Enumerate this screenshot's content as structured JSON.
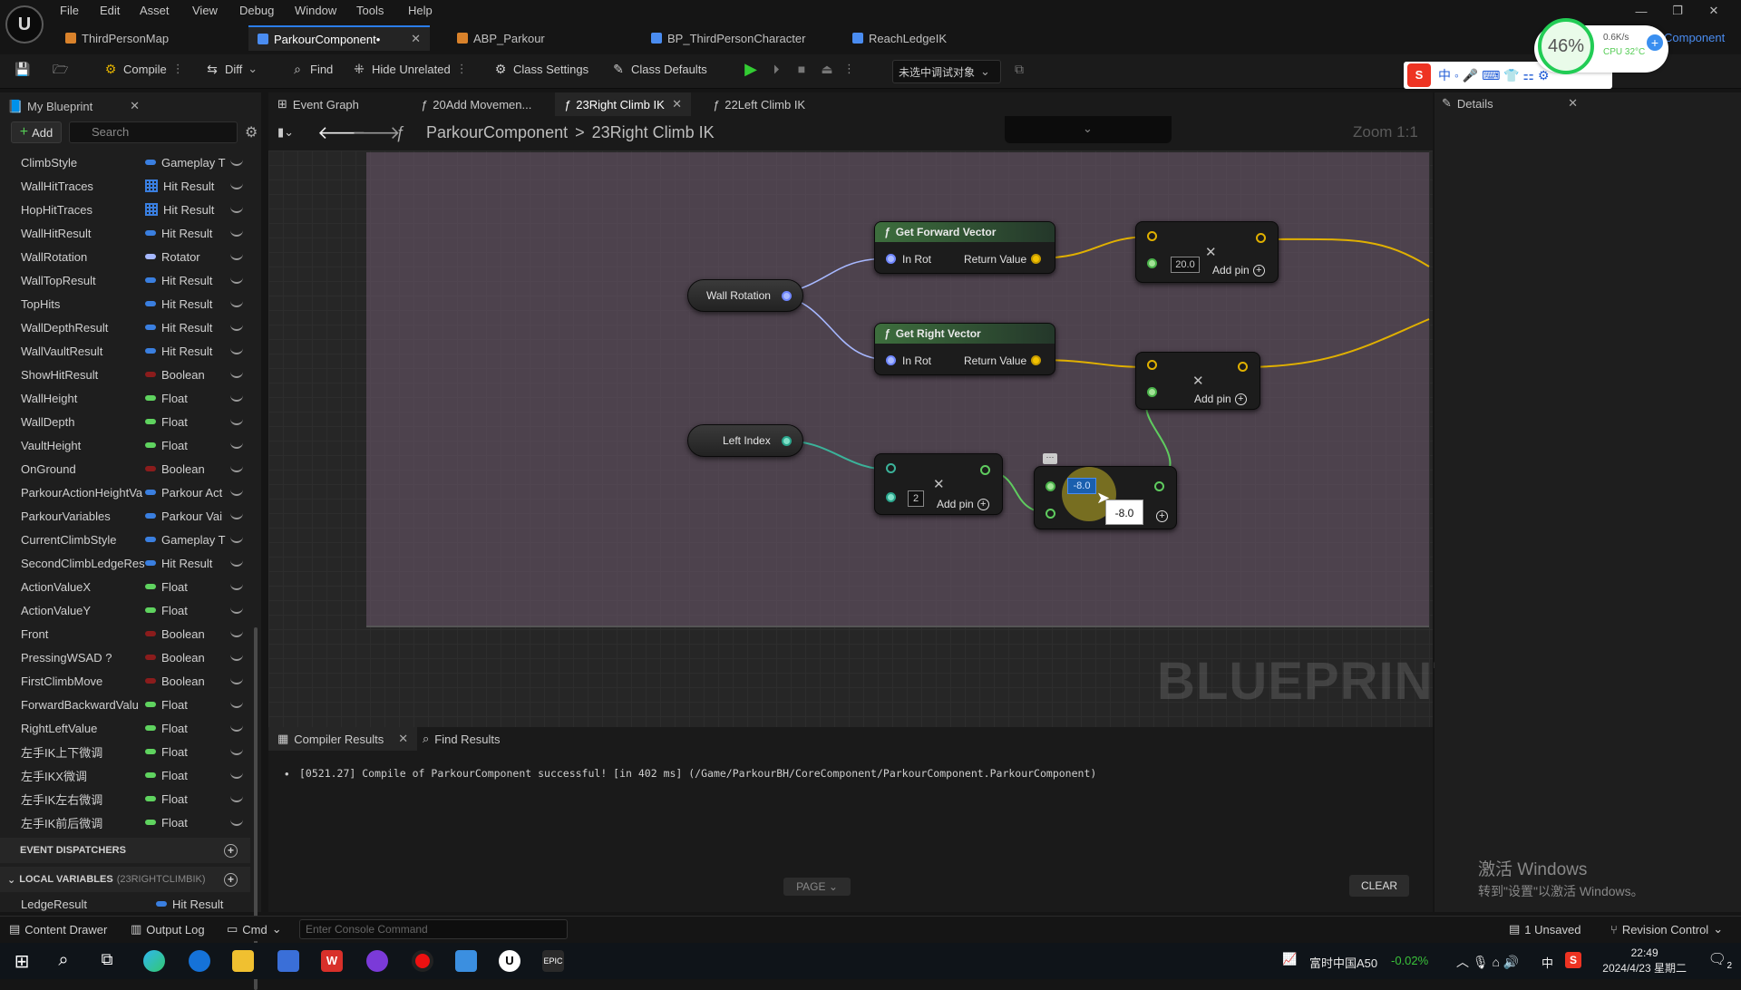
{
  "menu": [
    "File",
    "Edit",
    "Asset",
    "View",
    "Debug",
    "Window",
    "Tools",
    "Help"
  ],
  "doc_tabs": [
    {
      "label": "ThirdPersonMap",
      "color": "#d9822b"
    },
    {
      "label": "ParkourComponent•",
      "color": "#4a8cf0",
      "active": true
    },
    {
      "label": "ABP_Parkour",
      "color": "#d9822b"
    },
    {
      "label": "BP_ThirdPersonCharacter",
      "color": "#4a8cf0"
    },
    {
      "label": "ReachLedgeIK",
      "color": "#4a8cf0"
    }
  ],
  "top_right_link": "Component",
  "toolbar": {
    "compile": "Compile",
    "diff": "Diff",
    "find": "Find",
    "hide_unrelated": "Hide Unrelated",
    "class_settings": "Class Settings",
    "class_defaults": "Class Defaults",
    "debug_target": "未选中调试对象"
  },
  "my_blueprint": {
    "tab": "My Blueprint",
    "add": "Add",
    "search_placeholder": "Search",
    "variables": [
      {
        "name": "ClimbStyle",
        "type": "Gameplay T",
        "color": "#3a7fe0",
        "kind": "pill"
      },
      {
        "name": "WallHitTraces",
        "type": "Hit Result",
        "color": "#3a7fe0",
        "kind": "grid"
      },
      {
        "name": "HopHitTraces",
        "type": "Hit Result",
        "color": "#3a7fe0",
        "kind": "grid"
      },
      {
        "name": "WallHitResult",
        "type": "Hit Result",
        "color": "#3a7fe0",
        "kind": "pill"
      },
      {
        "name": "WallRotation",
        "type": "Rotator",
        "color": "#a6b8ff",
        "kind": "pill"
      },
      {
        "name": "WallTopResult",
        "type": "Hit Result",
        "color": "#3a7fe0",
        "kind": "pill"
      },
      {
        "name": "TopHits",
        "type": "Hit Result",
        "color": "#3a7fe0",
        "kind": "pill"
      },
      {
        "name": "WallDepthResult",
        "type": "Hit Result",
        "color": "#3a7fe0",
        "kind": "pill"
      },
      {
        "name": "WallVaultResult",
        "type": "Hit Result",
        "color": "#3a7fe0",
        "kind": "pill"
      },
      {
        "name": "ShowHitResult",
        "type": "Boolean",
        "color": "#8b1c1c",
        "kind": "pill"
      },
      {
        "name": "WallHeight",
        "type": "Float",
        "color": "#5fd35f",
        "kind": "pill"
      },
      {
        "name": "WallDepth",
        "type": "Float",
        "color": "#5fd35f",
        "kind": "pill"
      },
      {
        "name": "VaultHeight",
        "type": "Float",
        "color": "#5fd35f",
        "kind": "pill"
      },
      {
        "name": "OnGround",
        "type": "Boolean",
        "color": "#8b1c1c",
        "kind": "pill"
      },
      {
        "name": "ParkourActionHeightVa",
        "type": "Parkour Act",
        "color": "#3a7fe0",
        "kind": "pill"
      },
      {
        "name": "ParkourVariables",
        "type": "Parkour Vai",
        "color": "#3a7fe0",
        "kind": "pill"
      },
      {
        "name": "CurrentClimbStyle",
        "type": "Gameplay T",
        "color": "#3a7fe0",
        "kind": "pill"
      },
      {
        "name": "SecondClimbLedgeRes",
        "type": "Hit Result",
        "color": "#3a7fe0",
        "kind": "pill"
      },
      {
        "name": "ActionValueX",
        "type": "Float",
        "color": "#5fd35f",
        "kind": "pill"
      },
      {
        "name": "ActionValueY",
        "type": "Float",
        "color": "#5fd35f",
        "kind": "pill"
      },
      {
        "name": "Front",
        "type": "Boolean",
        "color": "#8b1c1c",
        "kind": "pill"
      },
      {
        "name": "PressingWSAD ?",
        "type": "Boolean",
        "color": "#8b1c1c",
        "kind": "pill"
      },
      {
        "name": "FirstClimbMove",
        "type": "Boolean",
        "color": "#8b1c1c",
        "kind": "pill"
      },
      {
        "name": "ForwardBackwardValu",
        "type": "Float",
        "color": "#5fd35f",
        "kind": "pill"
      },
      {
        "name": "RightLeftValue",
        "type": "Float",
        "color": "#5fd35f",
        "kind": "pill"
      },
      {
        "name": "左手IK上下微调",
        "type": "Float",
        "color": "#5fd35f",
        "kind": "pill"
      },
      {
        "name": "左手IKX微调",
        "type": "Float",
        "color": "#5fd35f",
        "kind": "pill"
      },
      {
        "name": "左手IK左右微调",
        "type": "Float",
        "color": "#5fd35f",
        "kind": "pill"
      },
      {
        "name": "左手IK前后微调",
        "type": "Float",
        "color": "#5fd35f",
        "kind": "pill"
      }
    ],
    "event_dispatchers": "EVENT DISPATCHERS",
    "local_variables": "LOCAL VARIABLES",
    "local_variables_scope": "(23RIGHTCLIMBIK)",
    "local_vars": [
      {
        "name": "LedgeResult",
        "type": "Hit Result"
      }
    ]
  },
  "graph_tabs": [
    "Event Graph",
    "20Add Movemen...",
    "23Right Climb IK",
    "22Left Climb IK"
  ],
  "breadcrumb": {
    "root": "ParkourComponent",
    "sep": ">",
    "current": "23Right Climb IK"
  },
  "zoom": "Zoom 1:1",
  "watermark": "BLUEPRINT",
  "nodes": {
    "get_forward": {
      "title": "Get Forward Vector",
      "in": "In Rot",
      "out": "Return Value"
    },
    "get_right": {
      "title": "Get Right Vector",
      "in": "In Rot",
      "out": "Return Value"
    },
    "wall_rotation": "Wall Rotation",
    "left_index": "Left Index",
    "mul_vec1": {
      "value": "20.0",
      "add_pin": "Add pin"
    },
    "mul_vec2": {
      "add_pin": "Add pin"
    },
    "mul_int": {
      "value": "2",
      "add_pin": "Add pin"
    },
    "mul_float": {
      "value": "-8.0",
      "tooltip": "-8.0"
    }
  },
  "bottom": {
    "compiler_results": "Compiler Results",
    "find_results": "Find Results",
    "log": "[0521.27] Compile of ParkourComponent successful! [in 402 ms] (/Game/ParkourBH/CoreComponent/ParkourComponent.ParkourComponent)",
    "page": "PAGE",
    "clear": "CLEAR"
  },
  "details": {
    "tab": "Details"
  },
  "activate_windows": {
    "line1": "激活 Windows",
    "line2": "转到\"设置\"以激活 Windows。"
  },
  "statusbar": {
    "content_drawer": "Content Drawer",
    "output_log": "Output Log",
    "cmd": "Cmd",
    "console_placeholder": "Enter Console Command",
    "unsaved": "1 Unsaved",
    "revision": "Revision Control"
  },
  "perf": {
    "cpu_pct": "46%",
    "net": "0.6K/s",
    "cpu_temp": "CPU 32°C"
  },
  "taskbar": {
    "stock_name": "富时中国A50",
    "stock_change": "-0.02%",
    "ime_lang": "中",
    "time": "22:49",
    "date": "2024/4/23 星期二",
    "notif_count": "2"
  }
}
